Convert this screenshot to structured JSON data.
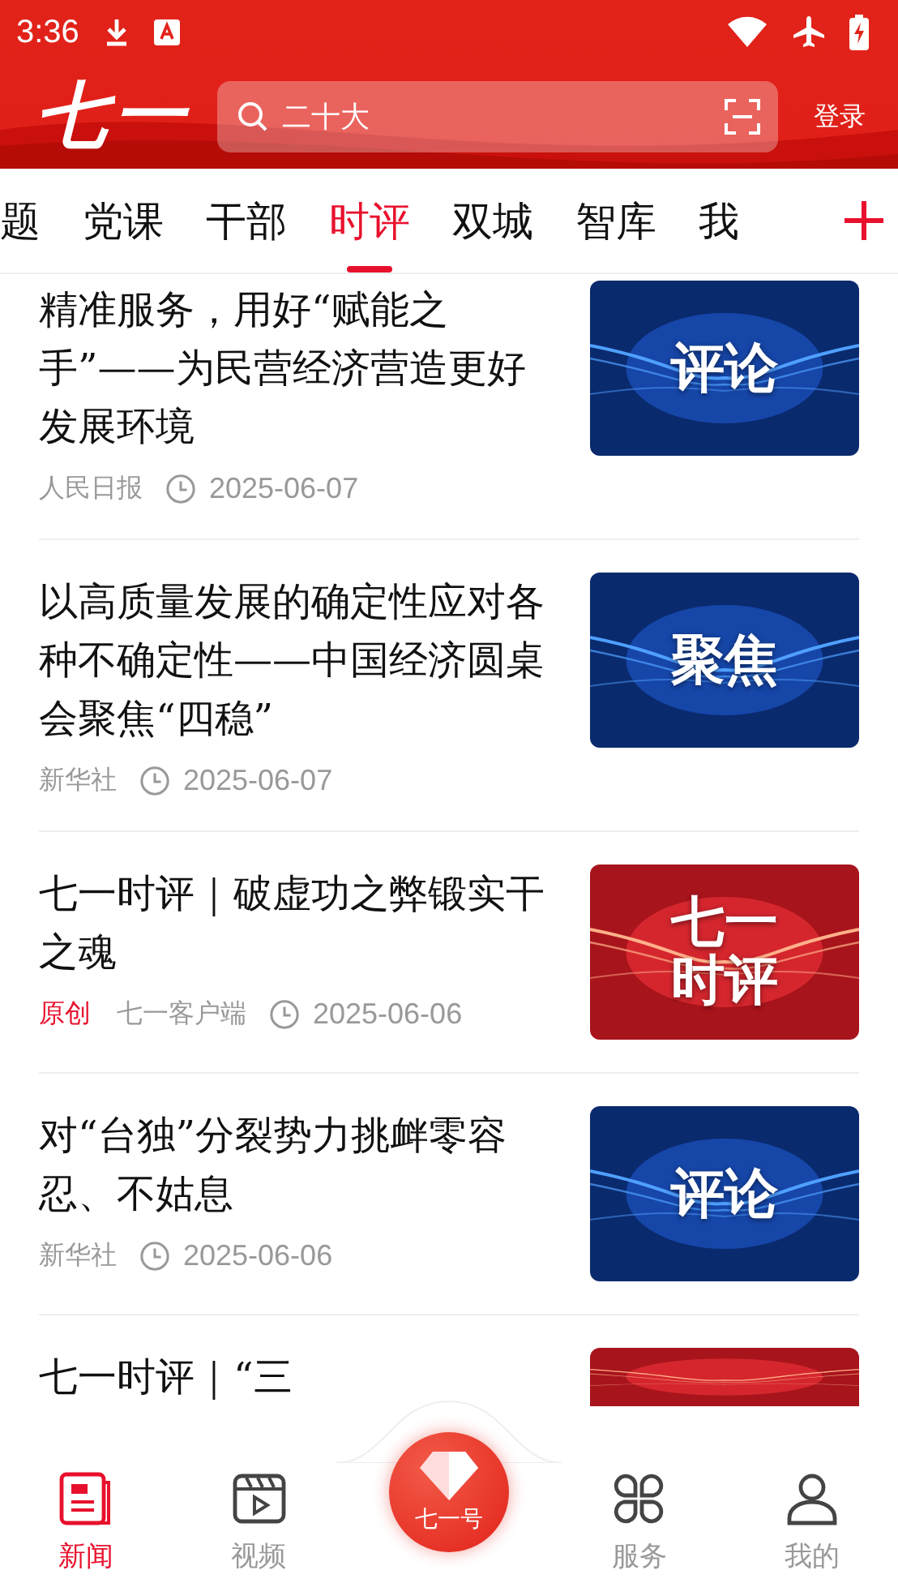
{
  "status_bar": {
    "time": "3:36"
  },
  "header": {
    "logo": "七一",
    "search": {
      "placeholder": "二十大"
    },
    "login": "登录"
  },
  "tabs": [
    {
      "label": "题",
      "selected": false
    },
    {
      "label": "党课",
      "selected": false
    },
    {
      "label": "干部",
      "selected": false
    },
    {
      "label": "时评",
      "selected": true
    },
    {
      "label": "双城",
      "selected": false
    },
    {
      "label": "智库",
      "selected": false
    },
    {
      "label": "我",
      "selected": false
    }
  ],
  "articles": [
    {
      "title": "精准服务，用好“赋能之手”——为民营经济营造更好发展环境",
      "source": "人民日报",
      "date": "2025-06-07",
      "thumbnail": {
        "kind": "blue",
        "text": "评论"
      }
    },
    {
      "title": "以高质量发展的确定性应对各种不确定性——中国经济圆桌会聚焦“四稳”",
      "source": "新华社",
      "date": "2025-06-07",
      "thumbnail": {
        "kind": "blue",
        "text": "聚焦"
      }
    },
    {
      "title": "七一时评｜破虚功之弊锻实干之魂",
      "tag": "原创",
      "source": "七一客户端",
      "date": "2025-06-06",
      "thumbnail": {
        "kind": "red",
        "text": "七一时评"
      }
    },
    {
      "title": "对“台独”分裂势力挑衅零容忍、不姑息",
      "source": "新华社",
      "date": "2025-06-06",
      "thumbnail": {
        "kind": "blue",
        "text": "评论"
      }
    },
    {
      "title": "七一时评｜“三",
      "thumbnail": {
        "kind": "red"
      }
    }
  ],
  "bottom_nav": [
    {
      "label": "新闻",
      "kind": "news",
      "selected": true
    },
    {
      "label": "视频",
      "kind": "video",
      "selected": false
    },
    {
      "label": "七一号",
      "kind": "center",
      "selected": false
    },
    {
      "label": "服务",
      "kind": "service",
      "selected": false
    },
    {
      "label": "我的",
      "kind": "profile",
      "selected": false
    }
  ]
}
